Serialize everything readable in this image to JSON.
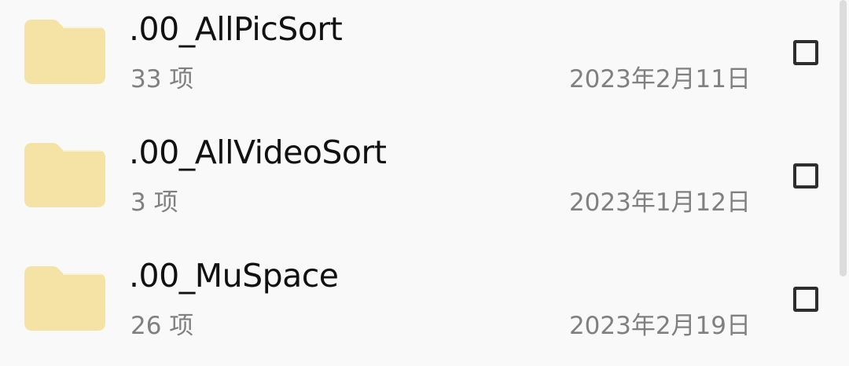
{
  "colors": {
    "background": "#f9f9f9",
    "folder_fill": "#f4e3a5",
    "name_text": "#111111",
    "meta_text": "#808080",
    "checkbox_border": "#2e2e2e",
    "scrollbar": "#dcdcdc"
  },
  "files": [
    {
      "icon": "folder-icon",
      "name": ".00_AllPicSort",
      "count": "33 项",
      "date": "2023年2月11日",
      "checked": false
    },
    {
      "icon": "folder-icon",
      "name": ".00_AllVideoSort",
      "count": "3 项",
      "date": "2023年1月12日",
      "checked": false
    },
    {
      "icon": "folder-icon",
      "name": ".00_MuSpace",
      "count": "26 项",
      "date": "2023年2月19日",
      "checked": false
    }
  ]
}
